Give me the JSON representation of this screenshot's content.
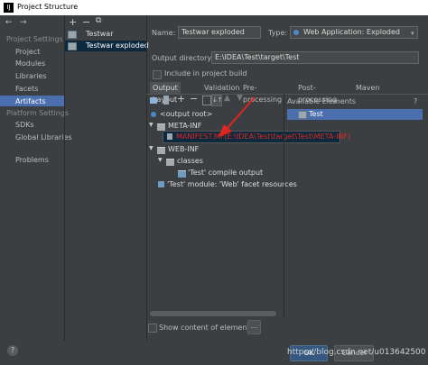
{
  "window": {
    "title": "Project Structure",
    "app_icon": "intellij-icon"
  },
  "nav": {
    "back": "←",
    "forward": "→"
  },
  "sidebar": {
    "project_settings": {
      "label": "Project Settings",
      "items": [
        {
          "label": "Project"
        },
        {
          "label": "Modules"
        },
        {
          "label": "Libraries"
        },
        {
          "label": "Facets"
        },
        {
          "label": "Artifacts"
        }
      ]
    },
    "platform_settings": {
      "label": "Platform Settings",
      "items": [
        {
          "label": "SDKs"
        },
        {
          "label": "Global Libraries"
        }
      ]
    },
    "problems": {
      "label": "Problems"
    }
  },
  "artifacts_list": {
    "toolbar": {
      "add": "+",
      "remove": "−",
      "copy": "⧉"
    },
    "items": [
      {
        "label": "Testwar"
      },
      {
        "label": "Testwar exploded",
        "selected": true
      }
    ]
  },
  "form": {
    "name_label": "Name:",
    "name_value": "Testwar exploded",
    "type_label": "Type:",
    "type_value": "Web Application: Exploded",
    "output_dir_label": "Output directory:",
    "output_dir_value": "E:\\IDEA\\Test\\target\\Test",
    "include_build_label": "Include in project build"
  },
  "tabs": [
    {
      "label": "Output Layout",
      "active": true
    },
    {
      "label": "Validation"
    },
    {
      "label": "Pre-processing"
    },
    {
      "label": "Post-processing"
    },
    {
      "label": "Maven"
    }
  ],
  "layout_tree": {
    "root": "<output root>",
    "meta_inf": "META-INF",
    "manifest": "MANIFEST.MF(E:\\IDEA\\Test\\target\\Test\\META-INF)",
    "web_inf": "WEB-INF",
    "classes": "classes",
    "compile_output": "'Test' compile output",
    "facet_resources": "'Test' module: 'Web' facet resources"
  },
  "available": {
    "title": "Available Elements",
    "help": "?",
    "items": [
      {
        "label": "Test"
      }
    ]
  },
  "show_content_label": "Show content of elements",
  "more_button": "...",
  "footer": {
    "help": "?",
    "ok": "OK",
    "cancel": "Cancel",
    "watermark": "https://blog.csdn.net/u013642500"
  },
  "colors": {
    "selection": "#4b6eaf",
    "background": "#3c3f41",
    "arrow": "#e0271f",
    "manifest_text": "#e0271f"
  }
}
